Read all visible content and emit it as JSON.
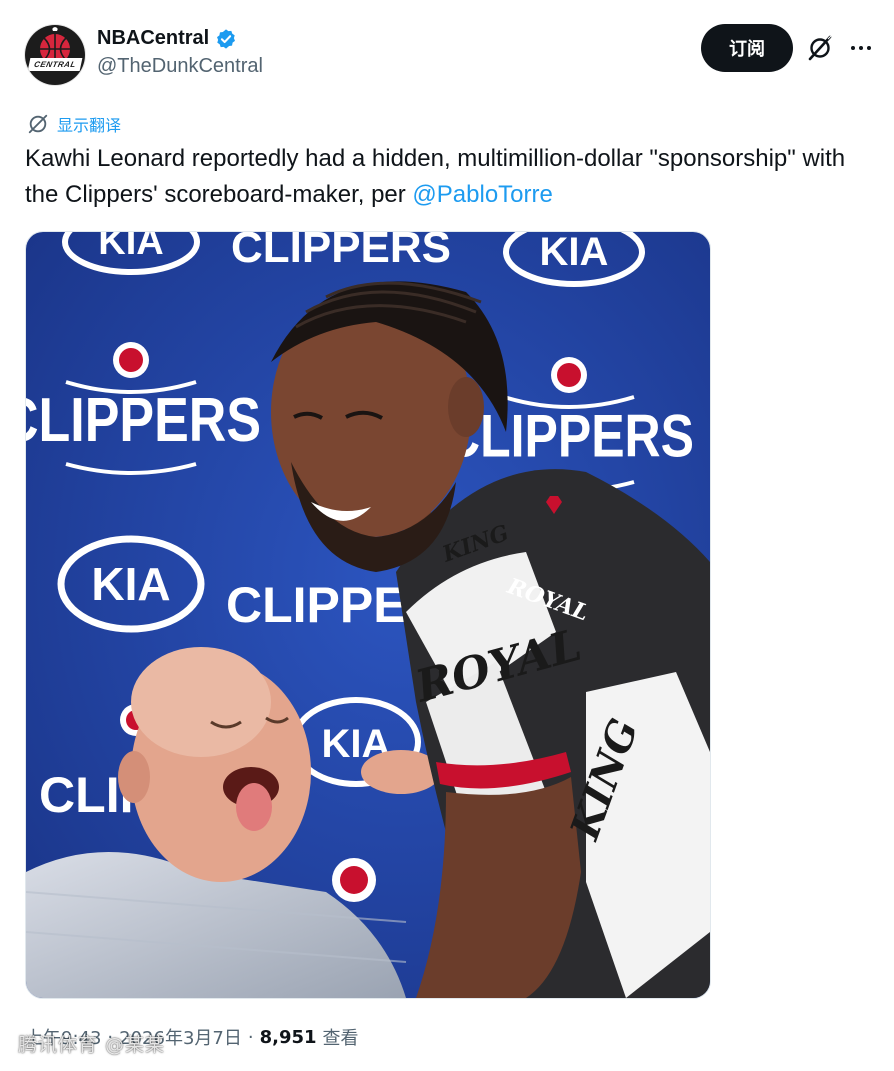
{
  "account": {
    "display_name": "NBACentral",
    "handle": "@TheDunkCentral",
    "avatar_text": "CENTRAL",
    "verified_color": "#1d9bf0"
  },
  "actions": {
    "subscribe_label": "订阅",
    "grok_icon": "grok-icon",
    "more_icon": "more-icon"
  },
  "translate": {
    "label": "显示翻译"
  },
  "tweet": {
    "text": "Kawhi Leonard reportedly had a hidden, multimillion-dollar \"sponsorship\" with the Clippers' scoreboard-maker, per ",
    "mention": "@PabloTorre"
  },
  "media": {
    "backdrop_logos": [
      "KIA",
      "CLIPPERS"
    ],
    "jersey_words": [
      "KING",
      "ROYAL"
    ]
  },
  "meta": {
    "time": "上午9:43",
    "date": "2026年3月7日",
    "separator": "·",
    "views_count": "8,951",
    "views_label": "查看"
  },
  "watermark": {
    "text": "腾讯体育 @某某"
  },
  "colors": {
    "accent": "#1d9bf0",
    "text": "#0f1419",
    "secondary": "#536471",
    "backdrop_blue": "#1f3f9e",
    "clippers_red": "#c8102e"
  }
}
